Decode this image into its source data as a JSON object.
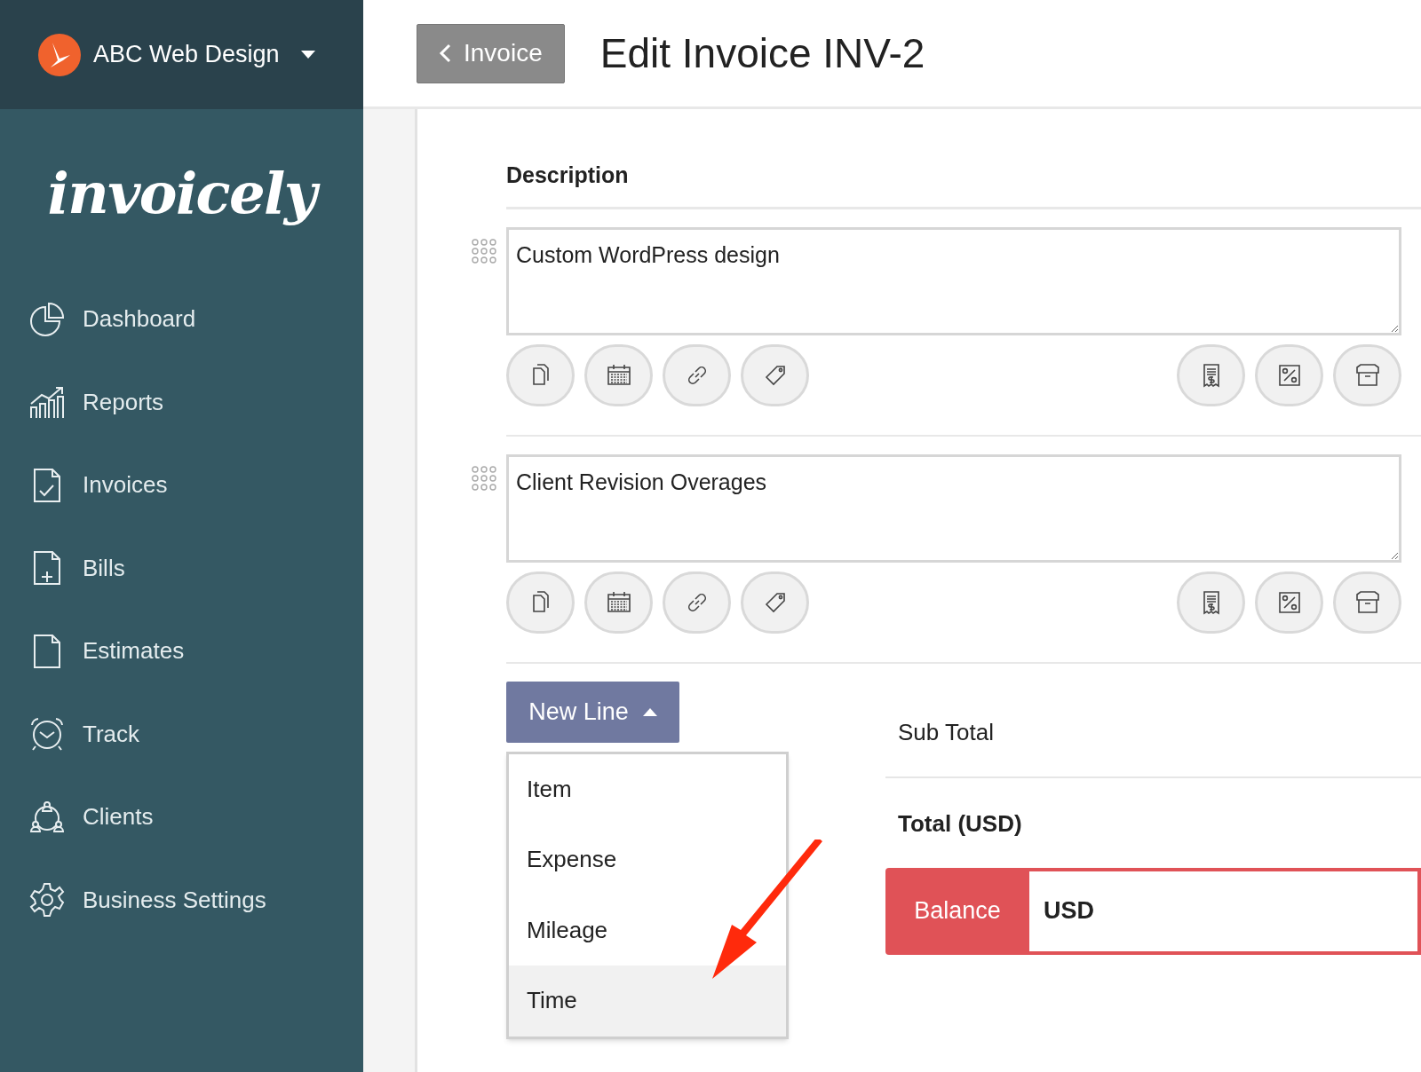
{
  "account": {
    "name": "ABC Web Design"
  },
  "logo": "invoicely",
  "sidebar": {
    "items": [
      {
        "label": "Dashboard"
      },
      {
        "label": "Reports"
      },
      {
        "label": "Invoices"
      },
      {
        "label": "Bills"
      },
      {
        "label": "Estimates"
      },
      {
        "label": "Track"
      },
      {
        "label": "Clients"
      },
      {
        "label": "Business Settings"
      }
    ]
  },
  "header": {
    "back_button": "Invoice",
    "title": "Edit Invoice INV-2"
  },
  "lines": {
    "column_heading": "Description",
    "rows": [
      {
        "description": "Custom WordPress design"
      },
      {
        "description": "Client Revision Overages"
      }
    ]
  },
  "new_line": {
    "label": "New Line",
    "expanded": true,
    "menu": [
      {
        "label": "Item",
        "selected": false
      },
      {
        "label": "Expense",
        "selected": false
      },
      {
        "label": "Mileage",
        "selected": false
      },
      {
        "label": "Time",
        "selected": true
      }
    ]
  },
  "totals": {
    "sub_total": "Sub Total",
    "total": "Total (USD)",
    "balance_label": "Balance",
    "balance_currency": "USD"
  }
}
